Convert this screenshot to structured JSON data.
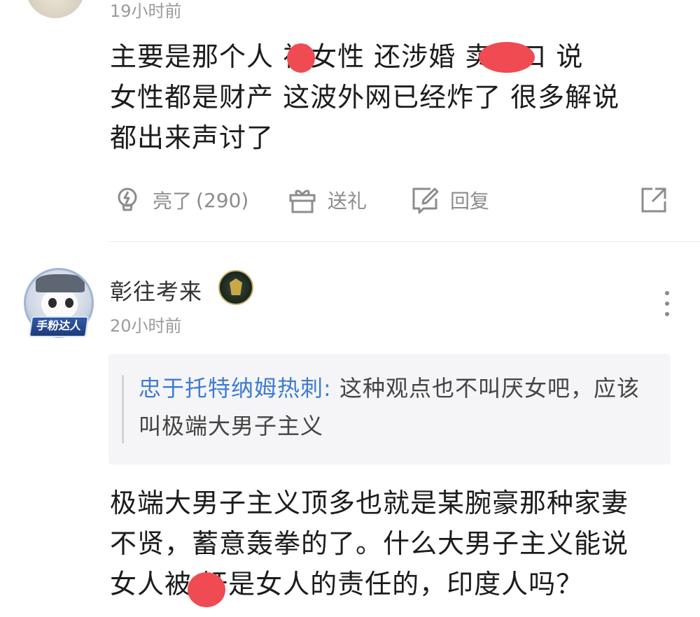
{
  "comment1": {
    "time": "19小时前",
    "text_lines": [
      "主要是那个人 视女性 还涉婚 卖人口 说",
      "女性都是财产 这波外网已经炸了 很多解说",
      "都出来声讨了"
    ],
    "actions": {
      "like_label": "亮了",
      "like_count": "(290)",
      "gift_label": "送礼",
      "reply_label": "回复"
    }
  },
  "comment2": {
    "username": "彰往考来",
    "avatar_badge": "手粉达人",
    "time": "20小时前",
    "quote": {
      "author": "忠于托特纳姆热刺:",
      "text": " 这种观点也不叫厌女吧，应该叫极端大男子主义"
    },
    "text_lines": [
      "极端大男子主义顶多也就是某腕豪那种家妻",
      "不贤，蓄意轰拳的了。什么大男子主义能说",
      "女人被 奸是女人的责任的，印度人吗？"
    ]
  },
  "icons": {
    "like": "lightbulb-icon",
    "gift": "gift-icon",
    "reply": "reply-edit-icon",
    "share": "share-icon",
    "more": "more-vertical-icon"
  },
  "colors": {
    "redaction": "#f04a52",
    "quote_author": "#3f7bd1",
    "secondary_text": "#8c8c8c"
  }
}
